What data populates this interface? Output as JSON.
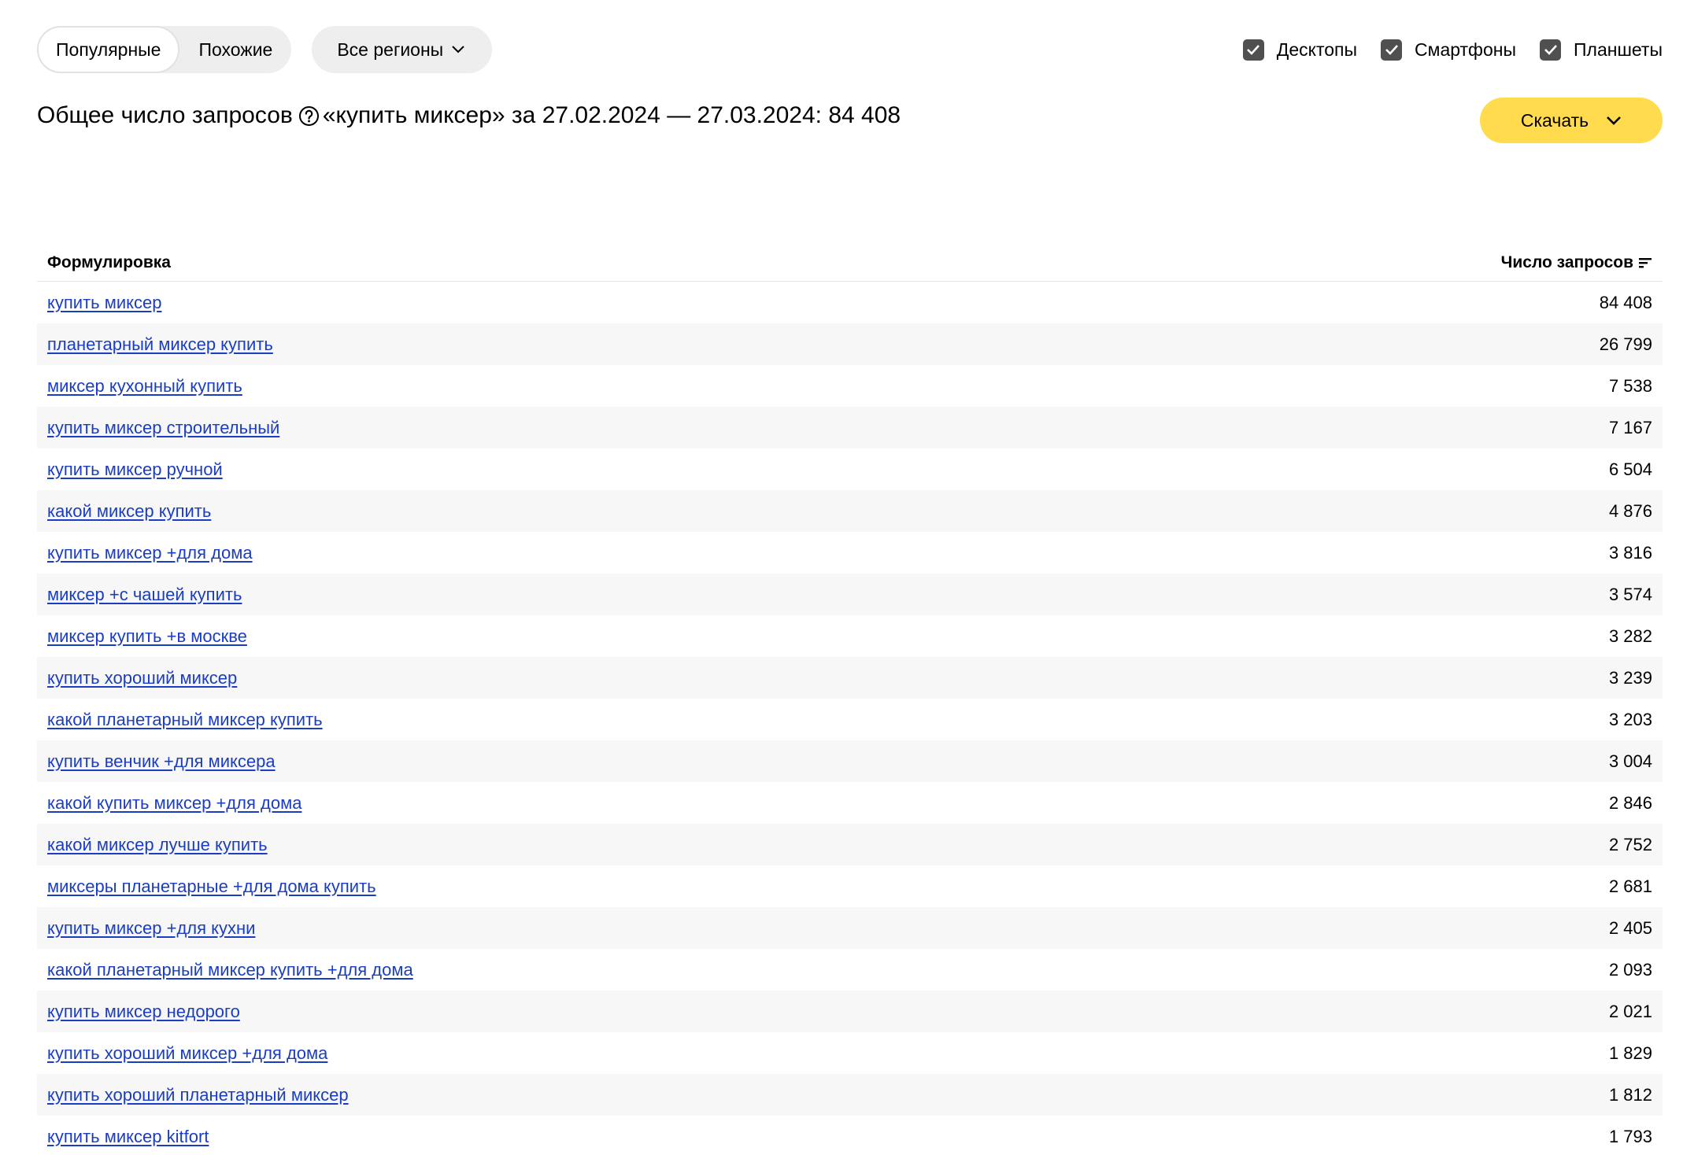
{
  "filters": {
    "tabs": [
      {
        "label": "Популярные",
        "active": true
      },
      {
        "label": "Похожие",
        "active": false
      }
    ],
    "region_label": "Все регионы",
    "devices": [
      {
        "label": "Десктопы",
        "checked": true
      },
      {
        "label": "Смартфоны",
        "checked": true
      },
      {
        "label": "Планшеты",
        "checked": true
      }
    ]
  },
  "summary": {
    "prefix": "Общее число запросов",
    "query_text": "«купить миксер» за 27.02.2024 — 27.03.2024: 84 408"
  },
  "download_label": "Скачать",
  "table": {
    "col_phrase": "Формулировка",
    "col_count": "Число запросов",
    "rows": [
      {
        "phrase": "купить миксер",
        "count": "84 408"
      },
      {
        "phrase": "планетарный миксер купить",
        "count": "26 799"
      },
      {
        "phrase": "миксер кухонный купить",
        "count": "7 538"
      },
      {
        "phrase": "купить миксер строительный",
        "count": "7 167"
      },
      {
        "phrase": "купить миксер ручной",
        "count": "6 504"
      },
      {
        "phrase": "какой миксер купить",
        "count": "4 876"
      },
      {
        "phrase": "купить миксер +для дома",
        "count": "3 816"
      },
      {
        "phrase": "миксер +с чашей купить",
        "count": "3 574"
      },
      {
        "phrase": "миксер купить +в москве",
        "count": "3 282"
      },
      {
        "phrase": "купить хороший миксер",
        "count": "3 239"
      },
      {
        "phrase": "какой планетарный миксер купить",
        "count": "3 203"
      },
      {
        "phrase": "купить венчик +для миксера",
        "count": "3 004"
      },
      {
        "phrase": "какой купить миксер +для дома",
        "count": "2 846"
      },
      {
        "phrase": "какой миксер лучше купить",
        "count": "2 752"
      },
      {
        "phrase": "миксеры планетарные +для дома купить",
        "count": "2 681"
      },
      {
        "phrase": "купить миксер +для кухни",
        "count": "2 405"
      },
      {
        "phrase": "какой планетарный миксер купить +для дома",
        "count": "2 093"
      },
      {
        "phrase": "купить миксер недорого",
        "count": "2 021"
      },
      {
        "phrase": "купить хороший миксер +для дома",
        "count": "1 829"
      },
      {
        "phrase": "купить хороший планетарный миксер",
        "count": "1 812"
      },
      {
        "phrase": "купить миксер kitfort",
        "count": "1 793"
      }
    ]
  },
  "colors": {
    "link": "#1a3dc1",
    "accent": "#ffdb4d",
    "checkbox": "#505050"
  }
}
